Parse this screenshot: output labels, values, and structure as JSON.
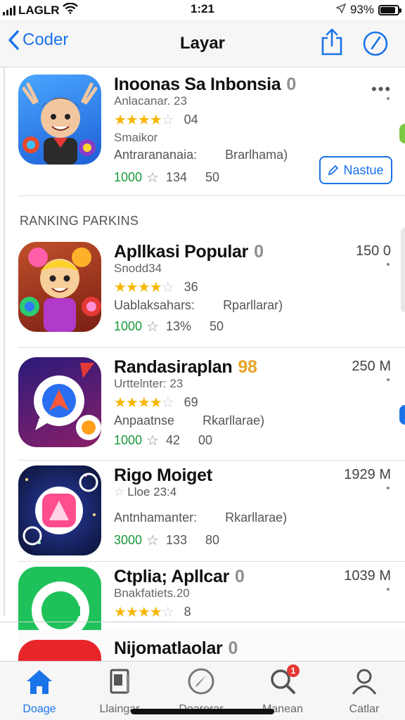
{
  "status_bar": {
    "carrier": "LAGLR",
    "time": "1:21",
    "battery": "93%"
  },
  "nav": {
    "back_label": "Coder",
    "title": "Layar"
  },
  "featured": {
    "name": "Inoonas Sa Inbonsia",
    "badge": "0",
    "subtitle": "Anlacanar. 23",
    "rating_count": "04",
    "category": "Smaikor",
    "info_a": "Antrarananaia:",
    "info_b": "Brarlhama)",
    "downloads": "1000",
    "stat_a": "134",
    "stat_b": "50",
    "update_label": "Nastue"
  },
  "section_title": "RANKING PARKINS",
  "apps": [
    {
      "name": "Apllkasi Popular",
      "badge": "0",
      "size": "150 0",
      "subtitle": "Snodd34",
      "rating_count": "36",
      "info_a": "Uablaksahars:",
      "info_b": "Rparllarar)",
      "downloads": "1000",
      "stat_a": "13%",
      "stat_b": "50"
    },
    {
      "name": "Randasiraplan",
      "badge": "98",
      "size": "250 M",
      "subtitle": "Urttelnter: 23",
      "rating_count": "69",
      "info_a": "Anpaatnse",
      "info_b": "Rkarllarae)",
      "downloads": "1000",
      "stat_a": "42",
      "stat_b": "00"
    },
    {
      "name": "Rigo Moiget",
      "badge": "",
      "size": "1929 M",
      "subtitle": "Lloe 23:4",
      "rating_count": "",
      "info_a": "Antnhamanter:",
      "info_b": "Rkarllarae)",
      "downloads": "3000",
      "stat_a": "133",
      "stat_b": "80"
    },
    {
      "name": "Ctplia; Apllcar",
      "badge": "0",
      "size": "1039 M",
      "subtitle": "Bnakfatiets.20",
      "rating_count": "8",
      "info_a": "",
      "info_b": "",
      "downloads": "",
      "stat_a": "",
      "stat_b": ""
    },
    {
      "name": "Nijomatlaolar",
      "badge": "0",
      "size": "",
      "subtitle": "",
      "rating_count": "",
      "info_a": "",
      "info_b": "",
      "downloads": "",
      "stat_a": "",
      "stat_b": ""
    }
  ],
  "tabs": [
    {
      "label": "Doage",
      "icon": "home-icon"
    },
    {
      "label": "Llaingar",
      "icon": "document-icon"
    },
    {
      "label": "Doarerar",
      "icon": "compass-icon"
    },
    {
      "label": "Manean",
      "icon": "search-icon",
      "badge": "1"
    },
    {
      "label": "Catlar",
      "icon": "person-icon"
    }
  ],
  "colors": {
    "accent": "#1a73e8",
    "star": "#f7b500",
    "green": "#1a9a3a"
  }
}
